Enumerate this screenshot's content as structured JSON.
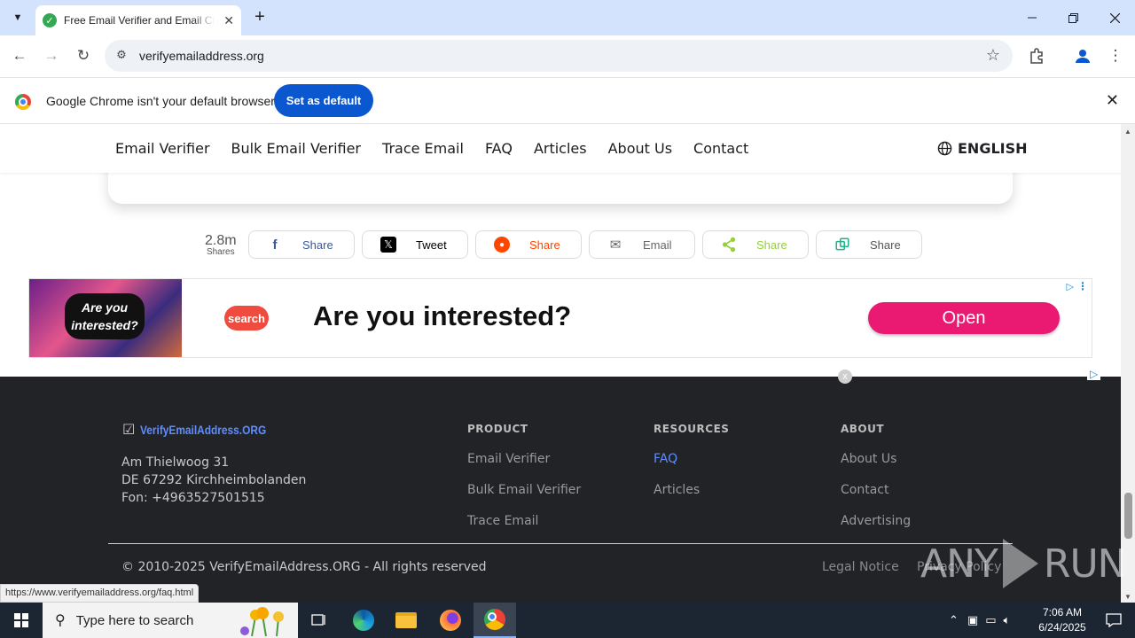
{
  "browser": {
    "tab_title": "Free Email Verifier and Email Ch",
    "url": "verifyemailaddress.org",
    "new_tab": "+",
    "tab_close": "✕"
  },
  "infobar": {
    "message": "Google Chrome isn't your default browser",
    "button": "Set as default"
  },
  "site_nav": {
    "links": [
      "Email Verifier",
      "Bulk Email Verifier",
      "Trace Email",
      "FAQ",
      "Articles",
      "About Us",
      "Contact"
    ],
    "language": "ENGLISH"
  },
  "share": {
    "count": "2.8m",
    "count_label": "Shares",
    "buttons": [
      {
        "label": "Share",
        "icon": "facebook-icon",
        "color": "#3b5998"
      },
      {
        "label": "Tweet",
        "icon": "x-icon",
        "color": "#000000"
      },
      {
        "label": "Share",
        "icon": "reddit-icon",
        "color": "#ff4500"
      },
      {
        "label": "Email",
        "icon": "email-icon",
        "color": "#666666"
      },
      {
        "label": "Share",
        "icon": "sharethis-icon",
        "color": "#95d03a"
      },
      {
        "label": "Share",
        "icon": "copy-icon",
        "color": "#20b38c"
      }
    ]
  },
  "ad": {
    "thumb_text_line1": "Are you",
    "thumb_text_line2": "interested?",
    "logo": "search",
    "headline": "Are you interested?",
    "cta": "Open",
    "close": "x"
  },
  "footer": {
    "brand": "VerifyEmailAddress.ORG",
    "address": [
      "Am Thielwoog 31",
      "DE 67292 Kirchheimbolanden",
      "Fon: +4963527501515"
    ],
    "columns": [
      {
        "heading": "PRODUCT",
        "links": [
          "Email Verifier",
          "Bulk Email Verifier",
          "Trace Email"
        ]
      },
      {
        "heading": "RESOURCES",
        "links": [
          "FAQ",
          "Articles"
        ]
      },
      {
        "heading": "ABOUT",
        "links": [
          "About Us",
          "Contact",
          "Advertising"
        ]
      }
    ],
    "copyright": "© 2010-2025 VerifyEmailAddress.ORG - All rights reserved",
    "legal_links": [
      "Legal Notice",
      "Privacy Policy"
    ]
  },
  "status_url": "https://www.verifyemailaddress.org/faq.html",
  "watermark": {
    "left": "ANY",
    "right": "RUN"
  },
  "taskbar": {
    "search_placeholder": "Type here to search",
    "time": "7:06 AM",
    "date": "6/24/2025"
  },
  "colors": {
    "tabstrip": "#d3e3fd",
    "set_default_btn": "#0b57d0",
    "footer_bg": "#222326",
    "footer_active_link": "#5f8dff",
    "ad_cta": "#ea1a73"
  }
}
